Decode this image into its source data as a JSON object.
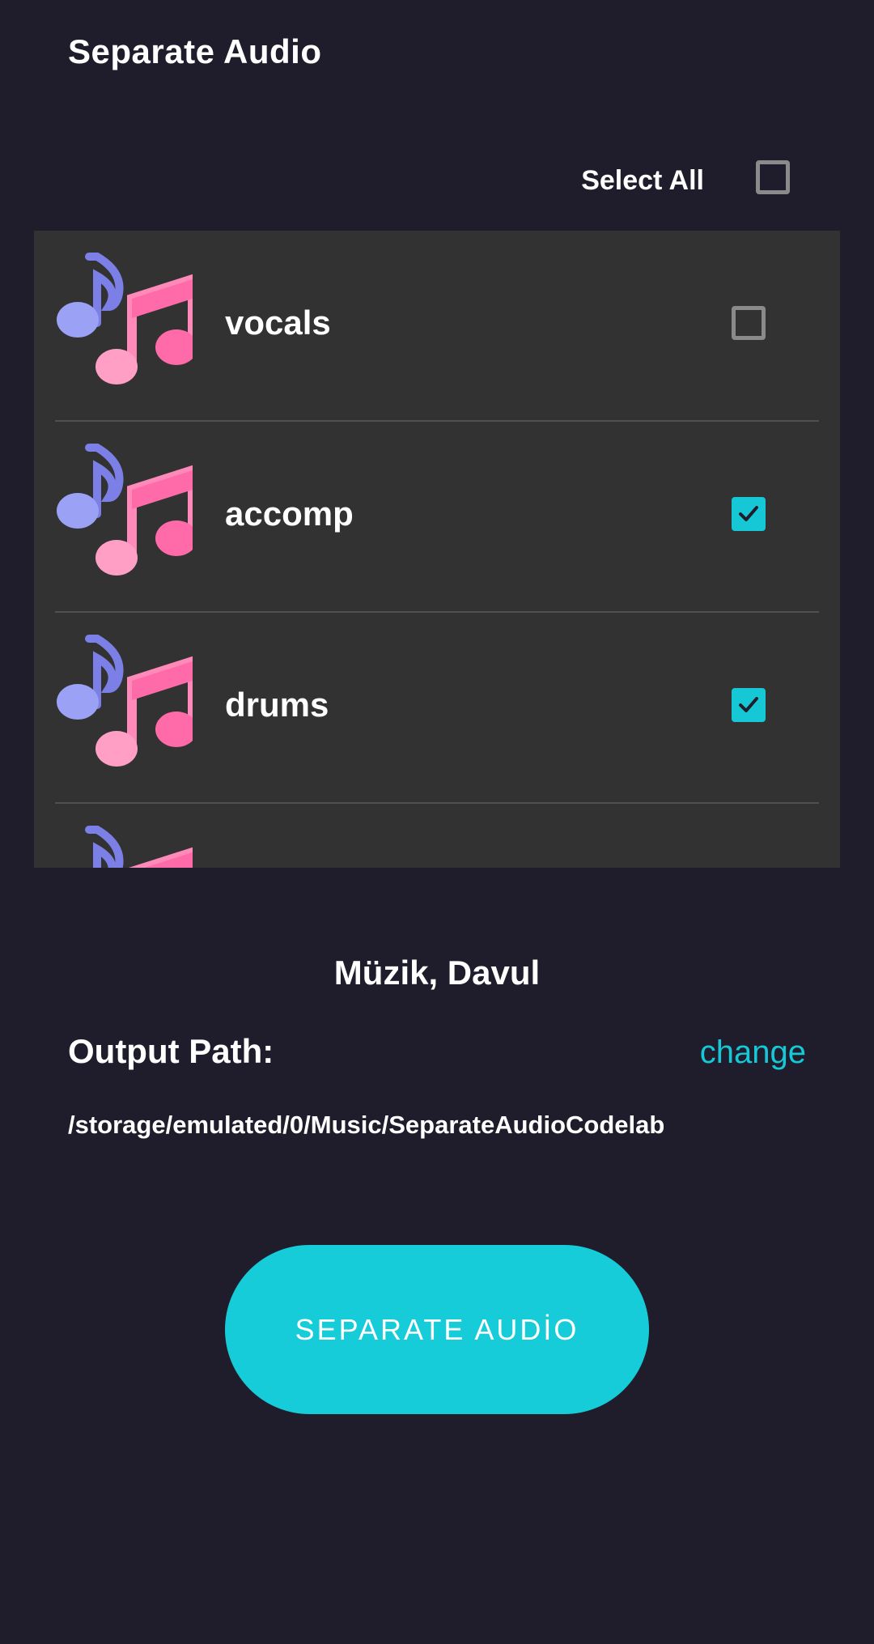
{
  "header": {
    "title": "Separate Audio"
  },
  "select_all": {
    "label": "Select All",
    "checked": false
  },
  "tracks": [
    {
      "name": "vocals",
      "checked": false,
      "icon": "music-notes-icon"
    },
    {
      "name": "accomp",
      "checked": true,
      "icon": "music-notes-icon"
    },
    {
      "name": "drums",
      "checked": true,
      "icon": "music-notes-icon"
    },
    {
      "name": "",
      "checked": false,
      "icon": "music-notes-icon"
    }
  ],
  "summary": {
    "selected_text": "Müzik, Davul"
  },
  "output": {
    "label": "Output Path:",
    "change_label": "change",
    "path": "/storage/emulated/0/Music/SeparateAudioCodelab"
  },
  "action": {
    "button_label": "SEPARATE AUDİO"
  },
  "colors": {
    "background": "#1f1d2b",
    "list_background": "#323232",
    "accent": "#16c8d6",
    "icon_note_blue": "#7b7fe6",
    "icon_note_pink": "#ff5fa2"
  }
}
